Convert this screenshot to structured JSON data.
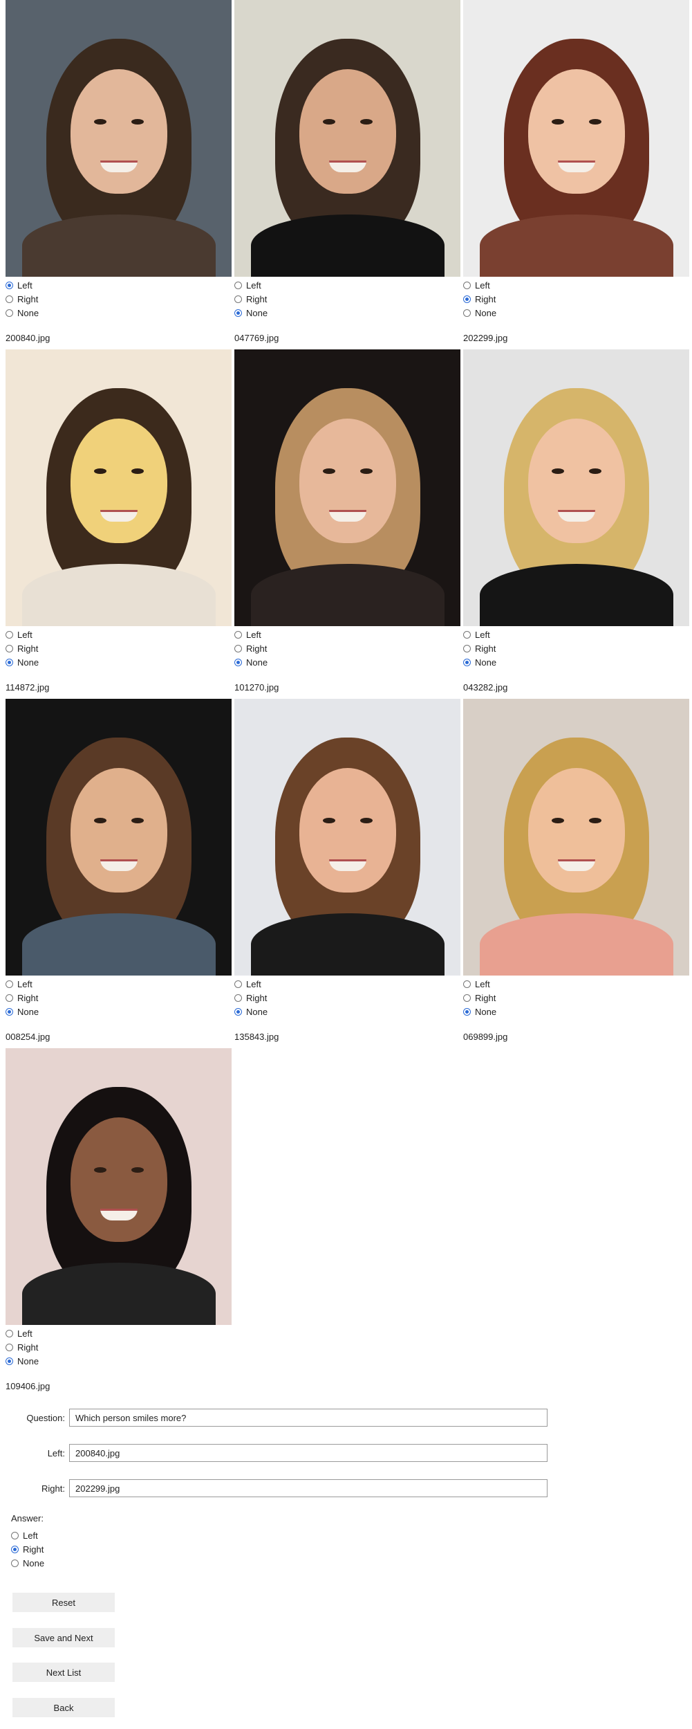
{
  "cards": [
    {
      "file": "200840.jpg",
      "selected": "left",
      "photo": {
        "bg": "#58626c",
        "hair": "#3a2a1e",
        "skin": "#e2b79a",
        "shirt": "#4a3a30"
      }
    },
    {
      "file": "047769.jpg",
      "selected": "none",
      "photo": {
        "bg": "#d9d7cc",
        "hair": "#3a2a20",
        "skin": "#d9a888",
        "shirt": "#121212"
      }
    },
    {
      "file": "202299.jpg",
      "selected": "right",
      "photo": {
        "bg": "#ececec",
        "hair": "#6a2f20",
        "skin": "#efc2a4",
        "shirt": "#7a4030"
      }
    },
    {
      "file": "114872.jpg",
      "selected": "none",
      "photo": {
        "bg": "#f1e6d6",
        "hair": "#3c2a1c",
        "skin": "#f0d17a",
        "shirt": "#e8e0d4"
      }
    },
    {
      "file": "101270.jpg",
      "selected": "none",
      "photo": {
        "bg": "#1a1514",
        "hair": "#b88e60",
        "skin": "#e7b89a",
        "shirt": "#2a2220"
      }
    },
    {
      "file": "043282.jpg",
      "selected": "none",
      "photo": {
        "bg": "#e3e3e3",
        "hair": "#d6b56a",
        "skin": "#f0c2a2",
        "shirt": "#151515"
      }
    },
    {
      "file": "008254.jpg",
      "selected": "none",
      "photo": {
        "bg": "#141414",
        "hair": "#5a3a26",
        "skin": "#e0b08c",
        "shirt": "#4a5a6a"
      }
    },
    {
      "file": "135843.jpg",
      "selected": "none",
      "photo": {
        "bg": "#e4e6ea",
        "hair": "#6a4228",
        "skin": "#e8b394",
        "shirt": "#1a1a1a"
      }
    },
    {
      "file": "069899.jpg",
      "selected": "none",
      "photo": {
        "bg": "#d8cfc6",
        "hair": "#c9a050",
        "skin": "#efbf9a",
        "shirt": "#e8a090"
      }
    },
    {
      "file": "109406.jpg",
      "selected": "none",
      "photo": {
        "bg": "#e6d4d0",
        "hair": "#151010",
        "skin": "#8a5a40",
        "shirt": "#222222"
      }
    }
  ],
  "option_labels": {
    "left": "Left",
    "right": "Right",
    "none": "None"
  },
  "form": {
    "question_label": "Question:",
    "question_value": "Which person smiles more?",
    "left_label": "Left:",
    "left_value": "200840.jpg",
    "right_label": "Right:",
    "right_value": "202299.jpg",
    "answer_label": "Answer:",
    "answer_selected": "right"
  },
  "buttons": {
    "reset": "Reset",
    "save_next": "Save and Next",
    "next_list": "Next List",
    "back": "Back"
  },
  "colors": {
    "radio_accent": "#2c6bd6",
    "button_bg": "#eeeeee"
  }
}
